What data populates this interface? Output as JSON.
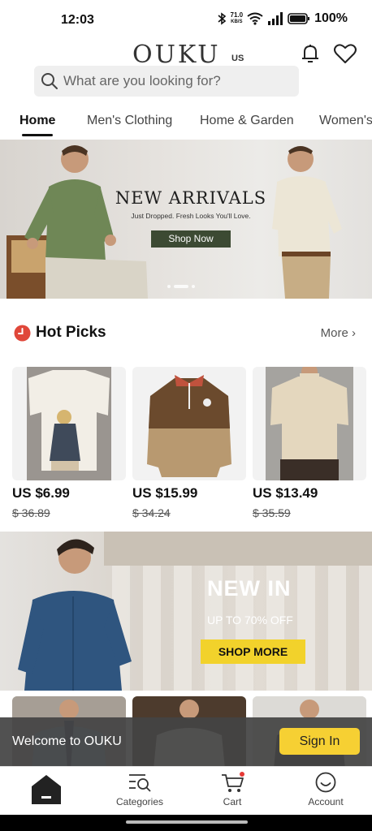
{
  "status_bar": {
    "time": "12:03",
    "net_speed_value": "71.0",
    "net_speed_unit": "KB/S",
    "battery": "100%",
    "icons": [
      "bluetooth-icon",
      "wifi-icon",
      "signal-icon",
      "battery-icon"
    ]
  },
  "header": {
    "logo": "OUKU",
    "region": "US",
    "icons": [
      "bell-icon",
      "heart-icon"
    ]
  },
  "search": {
    "placeholder": "What are you looking for?"
  },
  "tabs": [
    {
      "label": "Home",
      "active": true
    },
    {
      "label": "Men's Clothing",
      "active": false
    },
    {
      "label": "Home & Garden",
      "active": false
    },
    {
      "label": "Women's",
      "active": false
    }
  ],
  "hero": {
    "title": "NEW ARRIVALS",
    "subtitle": "Just Dropped. Fresh Looks You'll Love.",
    "button": "Shop Now",
    "slide_count": 3,
    "active_slide": 2
  },
  "hot_picks": {
    "title": "Hot Picks",
    "more": "More",
    "products": [
      {
        "price": "US $6.99",
        "old_price": "$ 36.89"
      },
      {
        "price": "US $15.99",
        "old_price": "$ 34.24"
      },
      {
        "price": "US $13.49",
        "old_price": "$ 35.59"
      }
    ]
  },
  "new_in": {
    "title": "NEW IN",
    "subtitle": "UP TO 70% OFF",
    "button": "SHOP MORE"
  },
  "toast": {
    "text": "Welcome to OUKU",
    "button": "Sign In"
  },
  "bottom_nav": [
    {
      "label": "",
      "icon": "home-icon"
    },
    {
      "label": "Categories",
      "icon": "categories-icon"
    },
    {
      "label": "Cart",
      "icon": "cart-icon"
    },
    {
      "label": "Account",
      "icon": "account-icon"
    }
  ],
  "colors": {
    "accent_yellow": "#f6d033",
    "hero_button": "#3c4a33",
    "hot_icon": "#e0473a"
  }
}
